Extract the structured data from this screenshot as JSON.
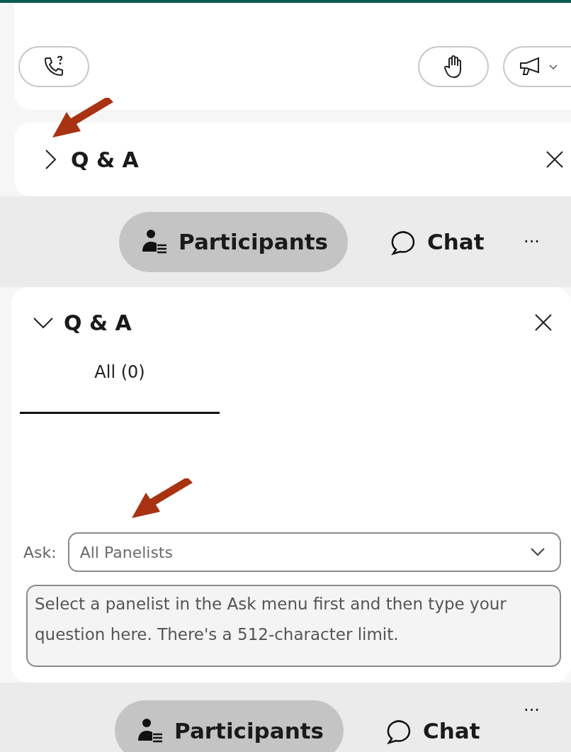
{
  "top_toolbar": {
    "buttons": [
      {
        "kind": "call-help"
      },
      {
        "kind": "raise-hand"
      },
      {
        "kind": "announce"
      }
    ]
  },
  "qa_collapsed": {
    "title": "Q & A",
    "expanded": false
  },
  "nav_bar_top": {
    "items": [
      {
        "kind": "participants",
        "label": "Participants",
        "selected": true
      },
      {
        "kind": "chat",
        "label": "Chat",
        "selected": false
      }
    ],
    "more": "···"
  },
  "qa_panel": {
    "title": "Q & A",
    "expanded": true,
    "tabs": [
      {
        "label": "All (0)",
        "selected": true
      }
    ],
    "ask_label": "Ask:",
    "ask_dropdown": {
      "value": "All Panelists"
    },
    "question_box": {
      "placeholder": "Select a panelist in the Ask menu first and then type your question here. There's a 512-character limit."
    }
  },
  "nav_bar_bottom": {
    "items": [
      {
        "kind": "participants",
        "label": "Participants",
        "selected": true
      },
      {
        "kind": "chat",
        "label": "Chat",
        "selected": false
      }
    ],
    "more": "···"
  }
}
